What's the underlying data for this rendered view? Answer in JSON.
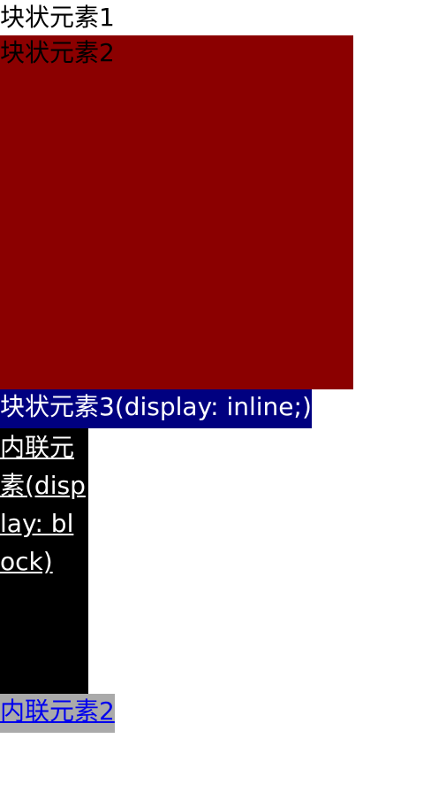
{
  "elements": {
    "block1": "块状元素1",
    "block2": "块状元素2",
    "block3": "块状元素3(display: inline;)",
    "inline1": "内联元素(display: block)",
    "inline2": "内联元素2"
  }
}
